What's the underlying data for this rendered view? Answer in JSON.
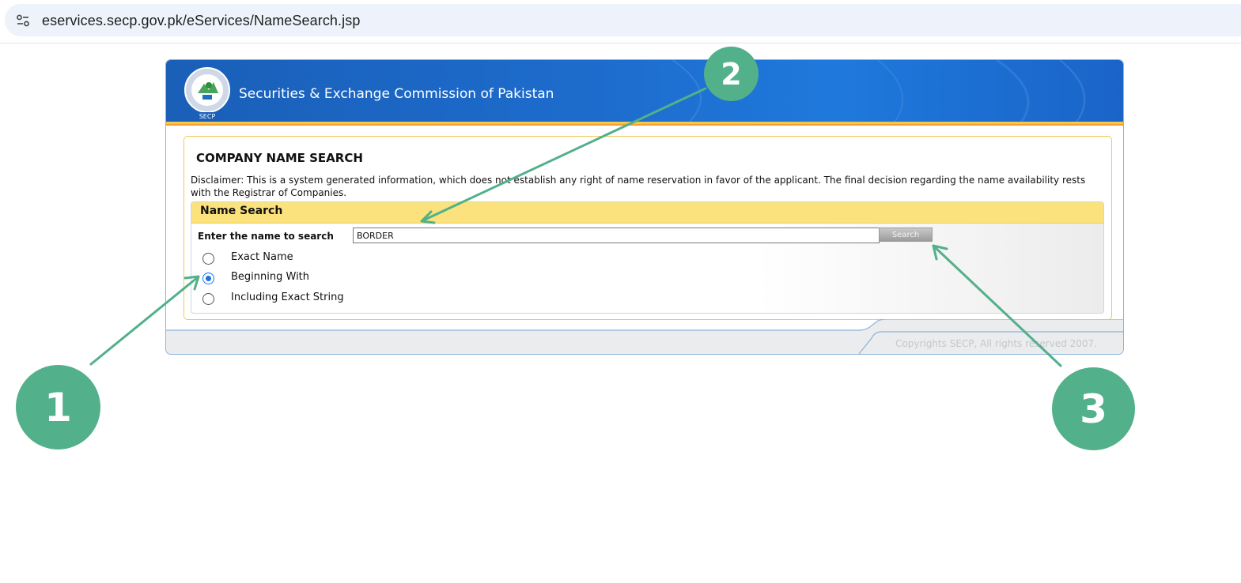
{
  "browser": {
    "url": "eservices.secp.gov.pk/eServices/NameSearch.jsp"
  },
  "header": {
    "org_name": "Securities & Exchange Commission of Pakistan",
    "logo_caption": "SECP"
  },
  "page": {
    "title": "COMPANY NAME SEARCH",
    "disclaimer": "Disclaimer: This is a system generated information, which does not establish any right of name reservation in favor of the applicant. The final decision regarding the name availability rests with the Registrar of Companies."
  },
  "search": {
    "section_title": "Name Search",
    "field_label": "Enter the name to search",
    "value": "BORDER",
    "button_label": "Search",
    "options": [
      {
        "label": "Exact Name",
        "checked": false
      },
      {
        "label": "Beginning With",
        "checked": true
      },
      {
        "label": "Including Exact String",
        "checked": false
      }
    ]
  },
  "footer": {
    "copyright": "Copyrights SECP, All rights reserved 2007."
  },
  "annotations": {
    "color": "#52b08a",
    "markers": [
      "1",
      "2",
      "3"
    ]
  },
  "colors": {
    "banner_blue": "#1d6ccd",
    "accent_yellow": "#fce27c",
    "radio_selected": "#1a73e8"
  }
}
